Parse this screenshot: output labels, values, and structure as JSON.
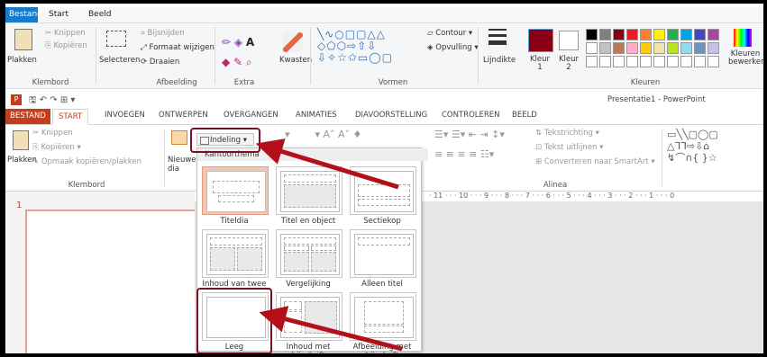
{
  "paint": {
    "tabs": [
      "Bestand",
      "Start",
      "Beeld"
    ],
    "clipboard": {
      "paste": "Plakken",
      "cut": "Knippen",
      "copy": "Kopiëren",
      "label": "Klembord"
    },
    "image": {
      "select": "Selecteren",
      "crop": "Bijsnijden",
      "resize": "Formaat wijzigen",
      "rotate": "Draaien",
      "label": "Afbeelding"
    },
    "extra": {
      "label": "Extra",
      "brushes": "Kwasten"
    },
    "shapes": {
      "contour": "Contour",
      "fill": "Opvulling",
      "label": "Vormen"
    },
    "colors": {
      "width": "Lijndikte",
      "color1": "Kleur 1",
      "color2": "Kleur 2",
      "edit": "Kleuren bewerken",
      "label": "Kleuren"
    },
    "palette": [
      "#000000",
      "#7f7f7f",
      "#880015",
      "#ed1c24",
      "#ff7f27",
      "#fff200",
      "#22b14c",
      "#00a2e8",
      "#3f48cc",
      "#a349a4",
      "#ffffff",
      "#c3c3c3",
      "#b97a57",
      "#ffaec9",
      "#ffc90e",
      "#efe4b0",
      "#b5e61d",
      "#99d9ea",
      "#7092be",
      "#c8bfe7"
    ],
    "active_color": "#880015"
  },
  "ppt": {
    "window_title": "Presentatie1 - PowerPoint",
    "tabs": [
      "BESTAND",
      "START",
      "INVOEGEN",
      "ONTWERPEN",
      "OVERGANGEN",
      "ANIMATIES",
      "DIAVOORSTELLING",
      "CONTROLEREN",
      "BEELD"
    ],
    "clipboard": {
      "paste": "Plakken",
      "cut": "Knippen",
      "copy": "Kopiëren",
      "format_painter": "Opmaak kopiëren/plakken",
      "label": "Klembord"
    },
    "new_slide": "Nieuwe dia",
    "layout_button": "Indeling",
    "paragraph": {
      "text_direction": "Tekstrichting",
      "align_text": "Tekst uitlijnen",
      "smartart": "Converteren naar SmartArt",
      "label": "Alinea"
    },
    "slide_number": "1",
    "ruler": "· 11 · · · 10 · · · 9 · · · 8 · · · 7 · · · 6 · · · 5 · · · 4 · · · 3 · · · 2 · · · 1 · · · 0",
    "dropdown": {
      "header": "Kantoorthema",
      "layouts": [
        "Titeldia",
        "Titel en object",
        "Sectiekop",
        "Inhoud van twee",
        "Vergelijking",
        "Alleen titel",
        "Leeg",
        "Inhoud met bijschrift",
        "Afbeelding met bijschrift"
      ]
    }
  },
  "accent": "#7a1020"
}
